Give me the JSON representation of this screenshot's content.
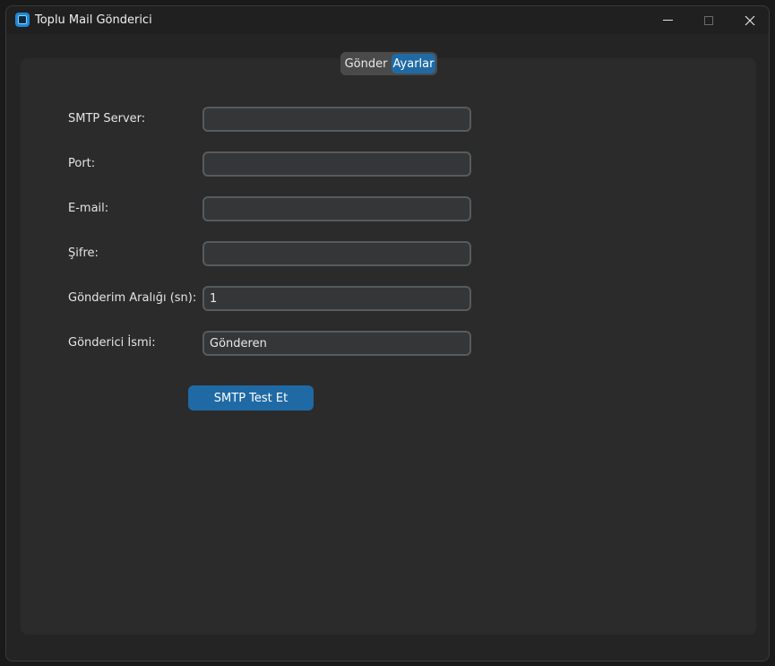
{
  "window": {
    "title": "Toplu Mail Gönderici",
    "icon": "app-icon",
    "controls": [
      "minimize-icon",
      "maximize-icon",
      "close-icon"
    ]
  },
  "tabs": [
    {
      "label": "Gönder",
      "selected": false
    },
    {
      "label": "Ayarlar",
      "selected": true
    }
  ],
  "form": {
    "smtp_server": {
      "label": "SMTP Server:",
      "value": ""
    },
    "port": {
      "label": "Port:",
      "value": ""
    },
    "email": {
      "label": "E-mail:",
      "value": ""
    },
    "password": {
      "label": "Şifre:",
      "value": ""
    },
    "interval": {
      "label": "Gönderim Aralığı (sn):",
      "value": "1"
    },
    "sender_name": {
      "label": "Gönderici İsmi:",
      "value": "Gönderen"
    }
  },
  "test_button_label": "SMTP Test Et",
  "colors": {
    "accent": "#1f6aa5",
    "background": "#242424",
    "panel": "#2b2b2b",
    "field_bg": "#343638",
    "field_border": "#565b5e"
  }
}
